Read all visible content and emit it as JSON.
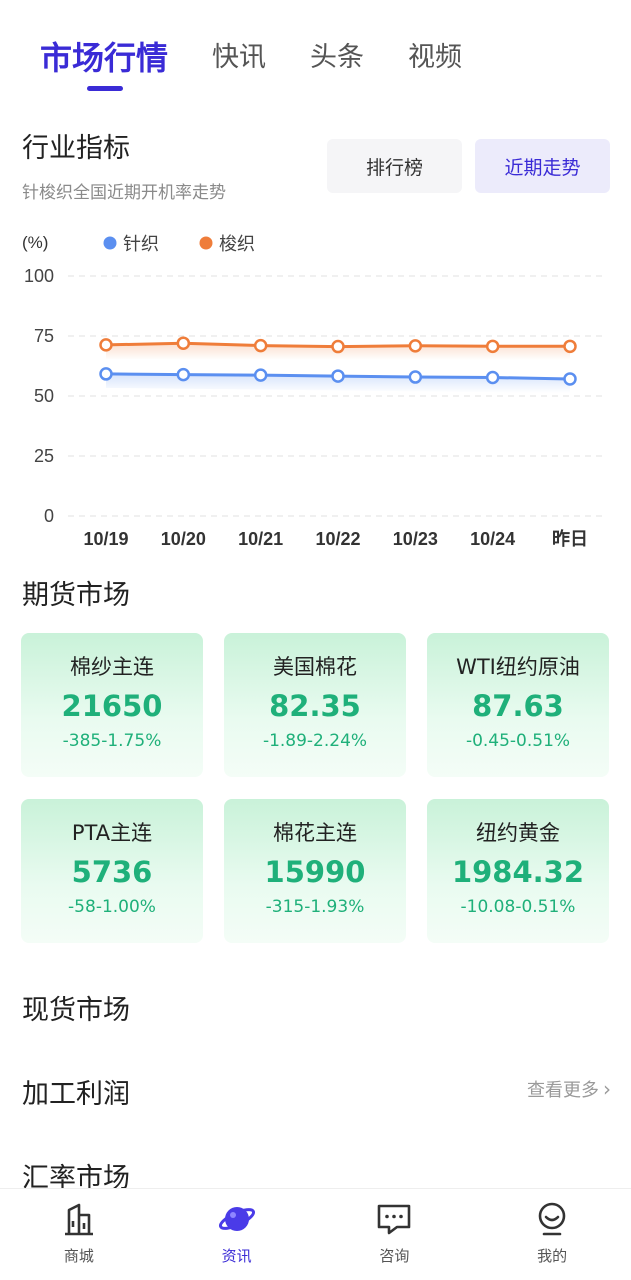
{
  "top_tabs": [
    {
      "label": "市场行情",
      "active": true
    },
    {
      "label": "快讯",
      "active": false
    },
    {
      "label": "头条",
      "active": false
    },
    {
      "label": "视频",
      "active": false
    }
  ],
  "industry": {
    "title": "行业指标",
    "subtitle": "针梭织全国近期开机率走势",
    "segment_rank": "排行榜",
    "segment_trend": "近期走势"
  },
  "chart_data": {
    "type": "line",
    "ylabel": "(%)",
    "ylim": [
      0,
      100
    ],
    "yticks": [
      0,
      25,
      50,
      75,
      100
    ],
    "x": [
      "10/19",
      "10/20",
      "10/21",
      "10/22",
      "10/23",
      "10/24",
      "昨日"
    ],
    "grid": true,
    "legend": "top-left",
    "series": [
      {
        "name": "针织",
        "color": "#5b8ff0",
        "values": [
          59.2,
          58.9,
          58.7,
          58.3,
          57.9,
          57.7,
          57.1
        ]
      },
      {
        "name": "梭织",
        "color": "#ef7d3a",
        "values": [
          71.3,
          72.0,
          71.0,
          70.6,
          70.9,
          70.7,
          70.7
        ]
      }
    ]
  },
  "futures": {
    "title": "期货市场",
    "items": [
      {
        "name": "棉纱主连",
        "value": "21650",
        "change": "-385-1.75%"
      },
      {
        "name": "美国棉花",
        "value": "82.35",
        "change": "-1.89-2.24%"
      },
      {
        "name": "WTI纽约原油",
        "value": "87.63",
        "change": "-0.45-0.51%"
      },
      {
        "name": "PTA主连",
        "value": "5736",
        "change": "-58-1.00%"
      },
      {
        "name": "棉花主连",
        "value": "15990",
        "change": "-315-1.93%"
      },
      {
        "name": "纽约黄金",
        "value": "1984.32",
        "change": "-10.08-0.51%"
      }
    ],
    "color_down": "#1fb07a"
  },
  "spot": {
    "title": "现货市场"
  },
  "profit": {
    "title": "加工利润",
    "more": "查看更多"
  },
  "fx": {
    "title": "汇率市场"
  },
  "bottom_nav": [
    {
      "label": "商城",
      "icon": "shop-building-icon",
      "active": false
    },
    {
      "label": "资讯",
      "icon": "planet-icon",
      "active": true
    },
    {
      "label": "咨询",
      "icon": "chat-bubble-icon",
      "active": false
    },
    {
      "label": "我的",
      "icon": "profile-face-icon",
      "active": false
    }
  ],
  "accent": "#3a2bd6"
}
